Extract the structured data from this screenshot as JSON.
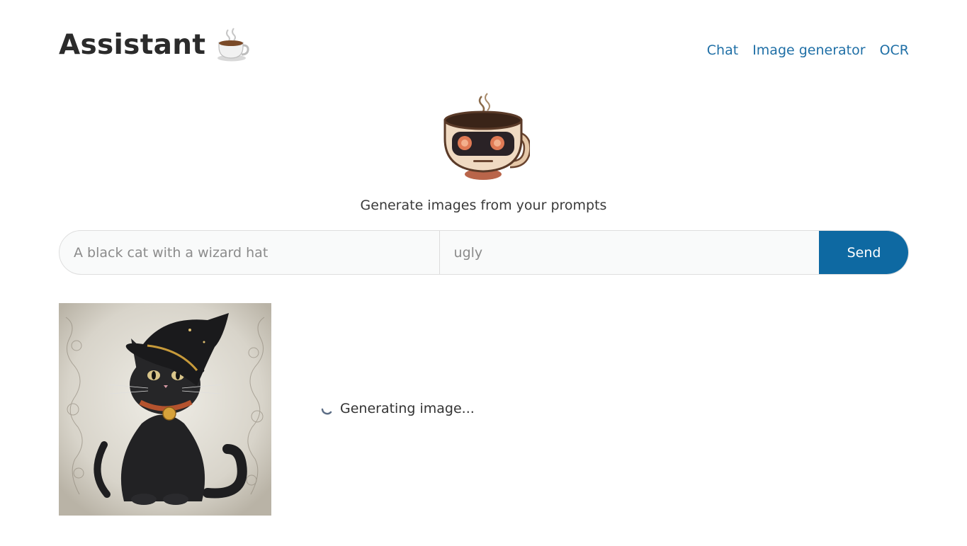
{
  "header": {
    "app_title": "Assistant",
    "brand_icon": "coffee-cup-icon",
    "nav": [
      {
        "label": "Chat"
      },
      {
        "label": "Image generator"
      },
      {
        "label": "OCR"
      }
    ]
  },
  "hero": {
    "mascot": "robot-coffee-cup-mascot",
    "subtitle": "Generate images from your prompts"
  },
  "form": {
    "prompt_placeholder": "A black cat with a wizard hat",
    "prompt_value": "",
    "negative_placeholder": "ugly",
    "negative_value": "",
    "send_label": "Send"
  },
  "results": {
    "image": "black-cat-wizard-hat-image",
    "status_text": "Generating image..."
  },
  "colors": {
    "accent": "#0e69a2",
    "link": "#1f6fa6"
  }
}
